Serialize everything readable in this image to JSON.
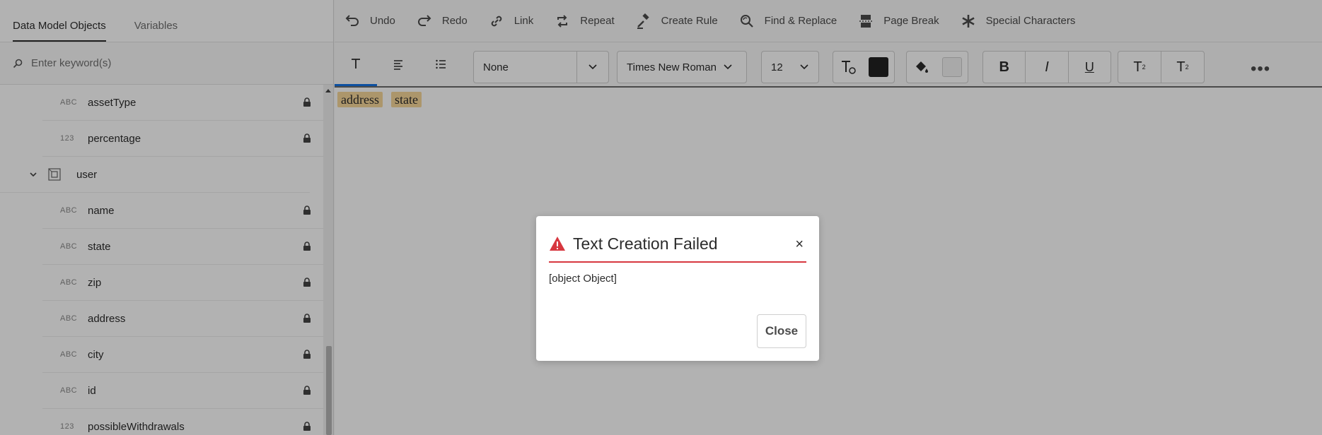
{
  "left_panel": {
    "tabs": [
      {
        "label": "Data Model Objects",
        "active": true
      },
      {
        "label": "Variables",
        "active": false
      }
    ],
    "search": {
      "placeholder": "Enter keyword(s)",
      "value": ""
    },
    "tree": {
      "rows_top": [
        {
          "type": "ABC",
          "label": "assetType",
          "locked": true
        },
        {
          "type": "123",
          "label": "percentage",
          "locked": true
        }
      ],
      "group": {
        "label": "user",
        "expanded": true
      },
      "rows_user": [
        {
          "type": "ABC",
          "label": "name",
          "locked": true
        },
        {
          "type": "ABC",
          "label": "state",
          "locked": true
        },
        {
          "type": "ABC",
          "label": "zip",
          "locked": true
        },
        {
          "type": "ABC",
          "label": "address",
          "locked": true
        },
        {
          "type": "ABC",
          "label": "city",
          "locked": true
        },
        {
          "type": "ABC",
          "label": "id",
          "locked": true
        },
        {
          "type": "123",
          "label": "possibleWithdrawals",
          "locked": true
        }
      ]
    }
  },
  "toolbar": {
    "undo": "Undo",
    "redo": "Redo",
    "link": "Link",
    "repeat": "Repeat",
    "create_rule": "Create Rule",
    "find_replace": "Find & Replace",
    "page_break": "Page Break",
    "special_characters": "Special Characters"
  },
  "format_bar": {
    "style_select": "None",
    "font_select": "Times New Roman",
    "size_select": "12",
    "text_color": "#222222",
    "highlight_color": "#f2f2f2",
    "bold": "B",
    "italic": "I",
    "underline": "U",
    "superscript": "T",
    "superscript_mark": "2",
    "subscript": "T",
    "subscript_mark": "2",
    "more": "•••"
  },
  "editor": {
    "chips": [
      "address",
      "state"
    ]
  },
  "dialog": {
    "title": "Text Creation Failed",
    "message": "[object Object]",
    "close_label": "Close",
    "close_x": "×"
  },
  "colors": {
    "accent": "#1473e6",
    "error": "#d7373f",
    "chip": "#f7d79a"
  }
}
